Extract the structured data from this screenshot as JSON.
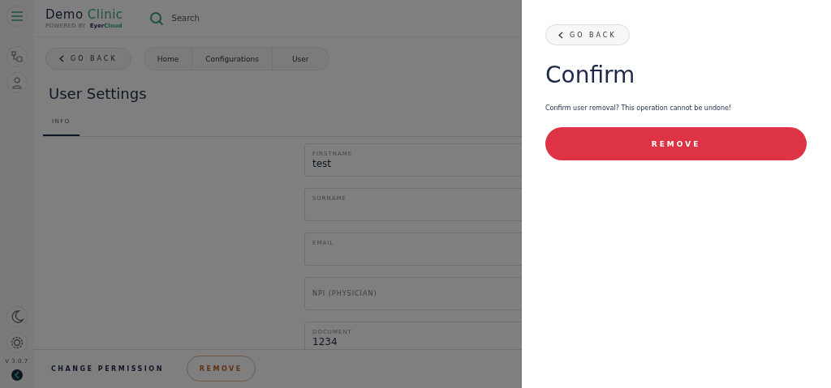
{
  "sidebar": {
    "version": "V 3.0.7"
  },
  "header": {
    "brand": {
      "name": "Demo",
      "accent": "Clinic",
      "powered_by": "POWERED BY",
      "maker": "Eyer",
      "maker_accent": "Cloud"
    },
    "search": {
      "placeholder": "Search"
    }
  },
  "toolbar": {
    "back": "GO BACK",
    "breadcrumbs": [
      "Home",
      "Configurations",
      "User"
    ]
  },
  "page": {
    "title": "User Settings",
    "tabs": [
      {
        "label": "INFO",
        "selected": true
      }
    ],
    "fields": [
      {
        "label": "FIRSTNAME",
        "value": "test"
      },
      {
        "label": "SURNAME"
      },
      {
        "label": "EMAIL"
      },
      {
        "placeholder": "NPI (PHYSICIAN)"
      },
      {
        "label": "DOCUMENT",
        "value": "1234"
      }
    ]
  },
  "footer": {
    "buttons": [
      {
        "label": "CHANGE PERMISSION",
        "kind": "text"
      },
      {
        "label": "REMOVE",
        "kind": "outline"
      }
    ]
  },
  "dialog": {
    "back": "GO BACK",
    "title": "Confirm",
    "message": "Confirm user removal? This operation cannot be undone!",
    "button": "REMOVE"
  }
}
